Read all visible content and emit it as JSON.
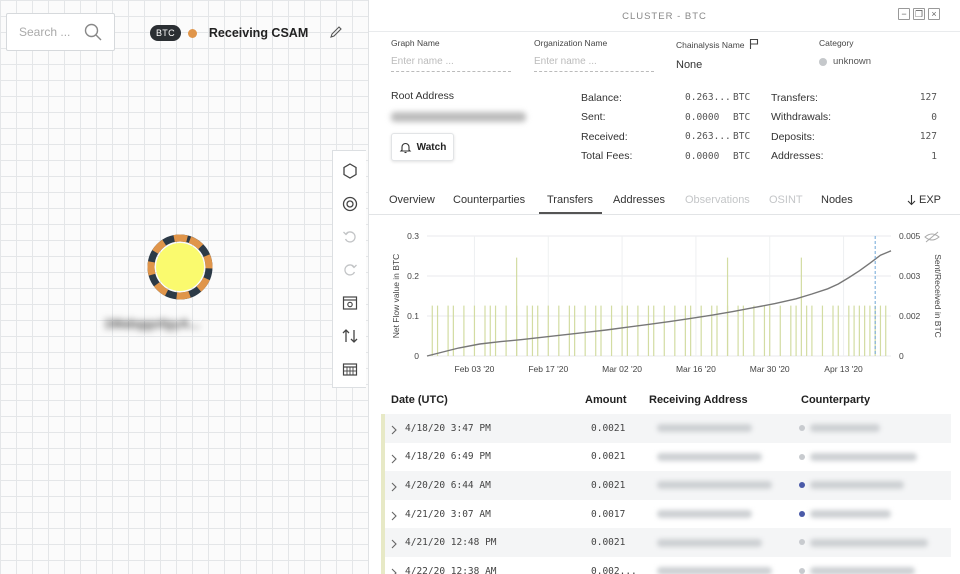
{
  "search": {
    "placeholder": "Search ..."
  },
  "graph": {
    "badge": "BTC",
    "name": "Receiving CSAM",
    "node_label": "1MabggsfgyA..."
  },
  "toolbar": {
    "icons": [
      "hexagon-icon",
      "target-icon",
      "undo-icon",
      "redo-icon",
      "panel-search-icon",
      "transfers-icon",
      "calendar-grid-icon"
    ]
  },
  "panel": {
    "title": "CLUSTER - BTC",
    "fields": {
      "graph_name_label": "Graph Name",
      "graph_name_placeholder": "Enter name ...",
      "org_name_label": "Organization Name",
      "org_name_placeholder": "Enter name ...",
      "chainalysis_label": "Chainalysis Name",
      "chainalysis_value": "None",
      "category_label": "Category",
      "category_value": "unknown"
    },
    "root_address_label": "Root Address",
    "watch_label": "Watch",
    "stats": {
      "balance_label": "Balance:",
      "balance_value": "0.263...",
      "balance_unit": "BTC",
      "sent_label": "Sent:",
      "sent_value": "0.0000",
      "sent_unit": "BTC",
      "received_label": "Received:",
      "received_value": "0.263...",
      "received_unit": "BTC",
      "fees_label": "Total Fees:",
      "fees_value": "0.0000",
      "fees_unit": "BTC",
      "transfers_label": "Transfers:",
      "transfers_value": "127",
      "withdrawals_label": "Withdrawals:",
      "withdrawals_value": "0",
      "deposits_label": "Deposits:",
      "deposits_value": "127",
      "addresses_label": "Addresses:",
      "addresses_value": "1"
    },
    "tabs": [
      "Overview",
      "Counterparties",
      "Transfers",
      "Addresses",
      "Observations",
      "OSINT",
      "Nodes"
    ],
    "active_tab": "Transfers",
    "export_label": "EXP",
    "table": {
      "headers": [
        "Date (UTC)",
        "Amount",
        "Receiving Address",
        "Counterparty"
      ],
      "rows": [
        {
          "date": "4/18/20 3:47 PM",
          "amount": "0.0021",
          "cp_color": "#c8cbcf"
        },
        {
          "date": "4/18/20 6:49 PM",
          "amount": "0.0021",
          "cp_color": "#c8cbcf"
        },
        {
          "date": "4/20/20 6:44 AM",
          "amount": "0.0021",
          "cp_color": "#4a5aa8"
        },
        {
          "date": "4/21/20 3:07 AM",
          "amount": "0.0017",
          "cp_color": "#4a5aa8"
        },
        {
          "date": "4/21/20 12:48 PM",
          "amount": "0.0021",
          "cp_color": "#c8cbcf"
        },
        {
          "date": "4/22/20 12:38 AM",
          "amount": "0.002...",
          "cp_color": "#c8cbcf"
        }
      ]
    }
  },
  "chart_data": {
    "type": "line",
    "ylabel": "Net Flow value in BTC",
    "y2label": "Sent/Received in BTC",
    "ylim": [
      0,
      0.3
    ],
    "y2lim": [
      0,
      0.005
    ],
    "yticks": [
      "0",
      "0.1",
      "0.2",
      "0.3"
    ],
    "y2ticks": [
      "0",
      "0.002",
      "0.003",
      "0.005"
    ],
    "xticks": [
      "Feb 03 '20",
      "Feb 17 '20",
      "Mar 02 '20",
      "Mar 16 '20",
      "Mar 30 '20",
      "Apr 13 '20"
    ],
    "xticks_days": [
      9,
      23,
      37,
      51,
      65,
      79
    ],
    "x_days_range": [
      0,
      88
    ],
    "series": [
      {
        "kind": "line",
        "x_days": [
          0,
          3,
          6,
          10,
          14,
          18,
          22,
          26,
          30,
          34,
          38,
          42,
          46,
          50,
          54,
          58,
          62,
          66,
          70,
          73,
          76,
          78,
          80,
          82,
          84,
          86,
          88
        ],
        "values": [
          0,
          0.01,
          0.02,
          0.03,
          0.036,
          0.041,
          0.047,
          0.053,
          0.059,
          0.065,
          0.072,
          0.079,
          0.086,
          0.094,
          0.102,
          0.111,
          0.121,
          0.131,
          0.143,
          0.155,
          0.168,
          0.18,
          0.196,
          0.213,
          0.232,
          0.252,
          0.263
        ]
      },
      {
        "kind": "bars",
        "axis": "y2",
        "value": 0.0021,
        "x_days": [
          1,
          2,
          4,
          5,
          7,
          9,
          11,
          12,
          13,
          15,
          17,
          19,
          20,
          21,
          23,
          25,
          27,
          28,
          30,
          32,
          33,
          35,
          37,
          38,
          40,
          42,
          43,
          45,
          47,
          49,
          50,
          52,
          54,
          55,
          57,
          59,
          60,
          62,
          64,
          65,
          67,
          69,
          70,
          72,
          73,
          75,
          77,
          78,
          80,
          81,
          82,
          83,
          84,
          85,
          86,
          87
        ],
        "tall_x_days": [
          17,
          57,
          71
        ]
      }
    ],
    "marker_day": 85
  }
}
